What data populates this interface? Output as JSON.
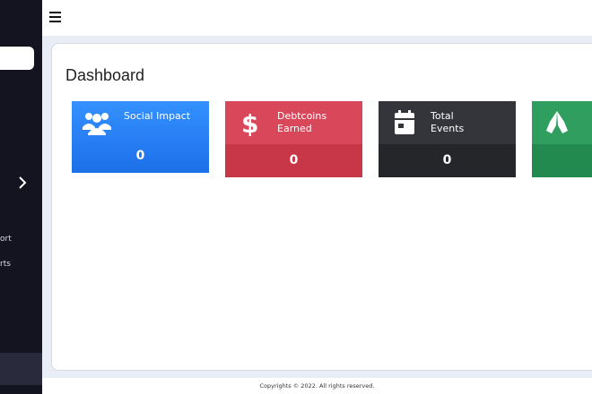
{
  "sidebar": {
    "items": [
      {
        "label": "ort"
      },
      {
        "label": "rts"
      }
    ]
  },
  "dashboard": {
    "title": "Dashboard",
    "cards": [
      {
        "label": "Social Impact",
        "value": "0",
        "icon": "users-icon",
        "color": "#2a7ef5"
      },
      {
        "label": "Debtcoins\nEarned",
        "value": "0",
        "icon": "dollar-icon",
        "color": "#d9485a"
      },
      {
        "label": "Total\nEvents",
        "value": "0",
        "icon": "calendar-icon",
        "color": "#33353a"
      },
      {
        "label": "",
        "value": "",
        "icon": "praying-hands-icon",
        "color": "#2f9e5e"
      }
    ]
  },
  "footer": {
    "text": "Copyrights © 2022. All rights reserved."
  }
}
